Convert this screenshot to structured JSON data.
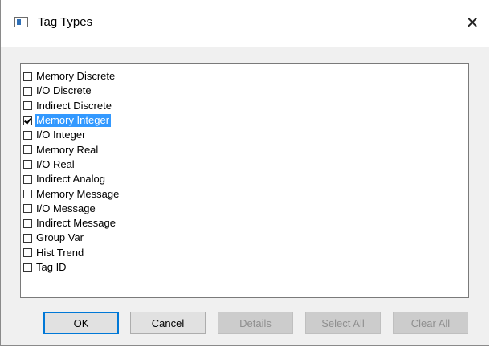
{
  "window": {
    "title": "Tag Types",
    "close_glyph": "✕",
    "icon": "app-window-icon"
  },
  "tag_list": {
    "items": [
      {
        "label": "Memory Discrete",
        "checked": false,
        "selected": false
      },
      {
        "label": "I/O Discrete",
        "checked": false,
        "selected": false
      },
      {
        "label": "Indirect Discrete",
        "checked": false,
        "selected": false
      },
      {
        "label": "Memory Integer",
        "checked": true,
        "selected": true
      },
      {
        "label": "I/O Integer",
        "checked": false,
        "selected": false
      },
      {
        "label": "Memory Real",
        "checked": false,
        "selected": false
      },
      {
        "label": "I/O Real",
        "checked": false,
        "selected": false
      },
      {
        "label": "Indirect Analog",
        "checked": false,
        "selected": false
      },
      {
        "label": "Memory Message",
        "checked": false,
        "selected": false
      },
      {
        "label": "I/O Message",
        "checked": false,
        "selected": false
      },
      {
        "label": "Indirect Message",
        "checked": false,
        "selected": false
      },
      {
        "label": "Group Var",
        "checked": false,
        "selected": false
      },
      {
        "label": "Hist Trend",
        "checked": false,
        "selected": false
      },
      {
        "label": "Tag ID",
        "checked": false,
        "selected": false
      }
    ]
  },
  "buttons": {
    "ok": {
      "label": "OK",
      "enabled": true,
      "default": true
    },
    "cancel": {
      "label": "Cancel",
      "enabled": true
    },
    "details": {
      "label": "Details",
      "enabled": false
    },
    "select_all": {
      "label": "Select All",
      "enabled": false
    },
    "clear_all": {
      "label": "Clear All",
      "enabled": false
    }
  },
  "colors": {
    "selection": "#3399ff",
    "default_button_border": "#0078d7",
    "dialog_background": "#f0f0f0"
  }
}
